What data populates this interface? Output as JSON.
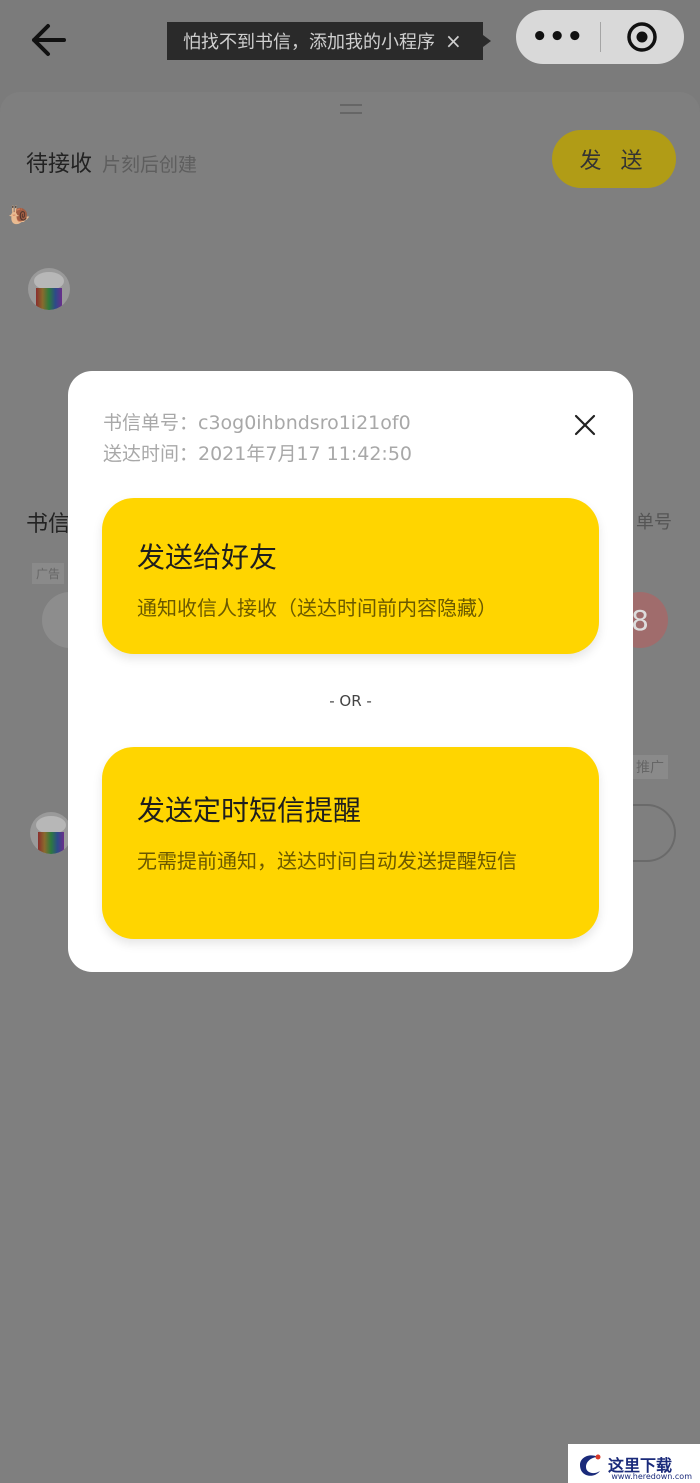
{
  "topbar": {
    "tip_text": "怕找不到书信，添加我的小程序",
    "tip_close": "×",
    "capsule_more": "•••"
  },
  "header": {
    "status": "待接收",
    "status_sub": "片刻后创建",
    "send_label": "发 送"
  },
  "background": {
    "letter_label": "书信",
    "right_label": "单号",
    "ad_badge": "广告",
    "promo_badge": "推广",
    "circle_digit": "8"
  },
  "modal": {
    "order_no": "书信单号：c3og0ihbndsro1i21of0",
    "delivery_time": "送达时间：2021年7月17 11:42:50",
    "option_friend": {
      "title": "发送给好友",
      "desc": "通知收信人接收（送达时间前内容隐藏）"
    },
    "separator": "- OR -",
    "option_sms": {
      "title": "发送定时短信提醒",
      "desc": "无需提前通知，送达时间自动发送提醒短信"
    }
  },
  "watermark": {
    "text": "这里下载",
    "url": "www.heredown.com"
  },
  "colors": {
    "accent": "#ffd500",
    "overlay": "#7b7b7b"
  }
}
